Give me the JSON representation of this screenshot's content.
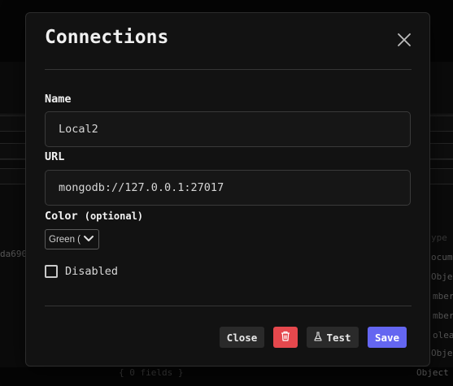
{
  "background": {
    "texts": {
      "id_fragment": "da690",
      "col_type": "ype",
      "t1": "ocume",
      "t2": "Object",
      "t3": "mber",
      "t4": "mber",
      "t5": "olea",
      "t6": "Object",
      "t7": "Object",
      "fields": "{ 0 fields }"
    }
  },
  "modal": {
    "title": "Connections",
    "name_label": "Name",
    "name_value": "Local2",
    "url_label": "URL",
    "url_value": "mongodb://127.0.0.1:27017",
    "color_label": "Color",
    "color_optional": "(optional)",
    "color_selected": "Green (",
    "disabled_label": "Disabled",
    "disabled_checked": false,
    "buttons": {
      "close": "Close",
      "test": "Test",
      "save": "Save"
    }
  },
  "colors": {
    "accent": "#6466f1",
    "danger": "#e5484d",
    "modal_bg": "#121212"
  },
  "icons": [
    "close-icon",
    "trash-icon",
    "flask-icon",
    "chevron-down-icon"
  ]
}
